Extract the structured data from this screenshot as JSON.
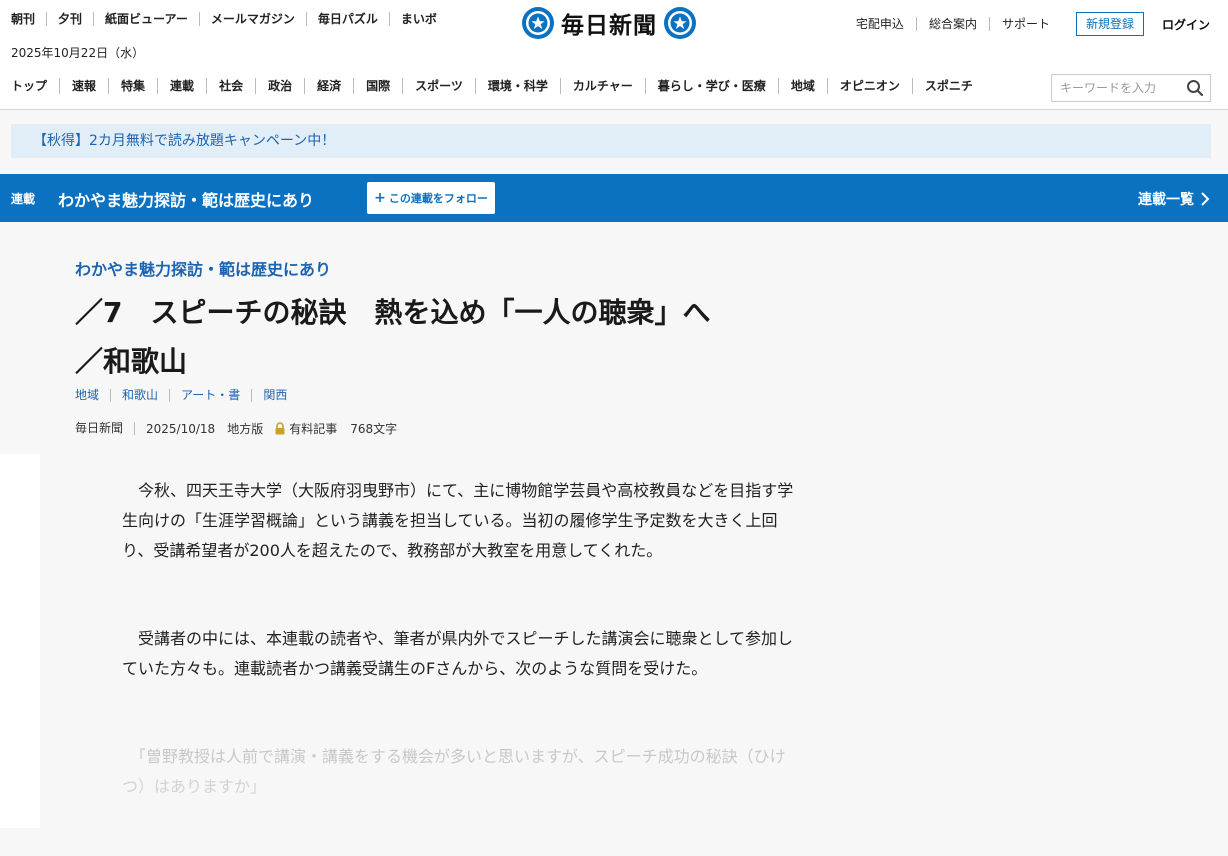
{
  "header": {
    "util_left": [
      "朝刊",
      "夕刊",
      "紙面ビューアー",
      "メールマガジン",
      "毎日パズル",
      "まいボ"
    ],
    "date": "2025年10月22日（水）",
    "logo_text": "毎日新聞",
    "util_right": [
      "宅配申込",
      "総合案内",
      "サポート"
    ],
    "signup_label": "新規登録",
    "login_label": "ログイン",
    "nav": [
      "トップ",
      "速報",
      "特集",
      "連載",
      "社会",
      "政治",
      "経済",
      "国際",
      "スポーツ",
      "環境・科学",
      "カルチャー",
      "暮らし・学び・医療",
      "地域",
      "オピニオン",
      "スポニチ"
    ],
    "search_placeholder": "キーワードを入力",
    "brand_color": "#0b72c2"
  },
  "campaign": {
    "text": "【秋得】2カ月無料で読み放題キャンペーン中！"
  },
  "series_bar": {
    "tag": "連載",
    "title": "わかやま魅力探訪・範は歴史にあり",
    "follow_label": "この連載をフォロー",
    "list_label": "連載一覧"
  },
  "article": {
    "kicker": "わかやま魅力探訪・範は歴史にあり",
    "headline_line1": "／7　スピーチの秘訣　熱を込め「一人の聴衆」へ",
    "headline_line2": "／和歌山",
    "tags": [
      "地域",
      "和歌山",
      "アート・書",
      "関西"
    ],
    "source": "毎日新聞",
    "date": "2025/10/18",
    "edition": "地方版",
    "paid_label": "有料記事",
    "char_count": "768文字",
    "paragraphs": [
      "　今秋、四天王寺大学（大阪府羽曳野市）にて、主に博物館学芸員や高校教員などを目指す学生向けの「生涯学習概論」という講義を担当している。当初の履修学生予定数を大きく上回り、受講希望者が200人を超えたので、教務部が大教室を用意してくれた。",
      "　受講者の中には、本連載の読者や、筆者が県内外でスピーチした講演会に聴衆として参加していた方々も。連載読者かつ講義受講生のFさんから、次のような質問を受けた。",
      "　「曽野教授は人前で講演・講義をする機会が多いと思いますが、スピーチ成功の秘訣（ひけつ）はありますか」"
    ]
  }
}
